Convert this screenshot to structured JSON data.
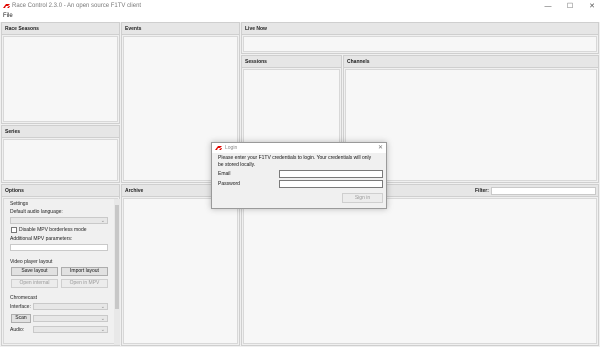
{
  "app": {
    "title": "Race Control 2.3.0 - An open source F1TV client",
    "menu_file": "File",
    "logo_icon": "f1-logo-icon",
    "accent": "#e10600"
  },
  "panels": {
    "race_seasons": "Race Seasons",
    "events": "Events",
    "live_now": "Live Now",
    "sessions": "Sessions",
    "channels": "Channels",
    "series": "Series",
    "options": "Options",
    "archive": "Archive",
    "filter_label": "Filter:"
  },
  "options": {
    "settings_group": "Settings",
    "default_audio_label": "Default audio language:",
    "disable_borderless": "Disable MPV borderless mode",
    "additional_params": "Additional MPV parameters:",
    "video_layout_group": "Video player layout",
    "save_layout": "Save layout",
    "import_layout": "Import layout",
    "open_internal": "Open internal",
    "open_in_mpv": "Open in MPV",
    "chromecast_group": "Chromecast",
    "interface_label": "Interface:",
    "scan": "Scan",
    "audio_label": "Audio:"
  },
  "login": {
    "title": "Login",
    "message": "Please enter your F1TV credentials to login. Your credentials will only be stored locally.",
    "email_label": "Email",
    "password_label": "Password",
    "signin": "Sign in"
  }
}
